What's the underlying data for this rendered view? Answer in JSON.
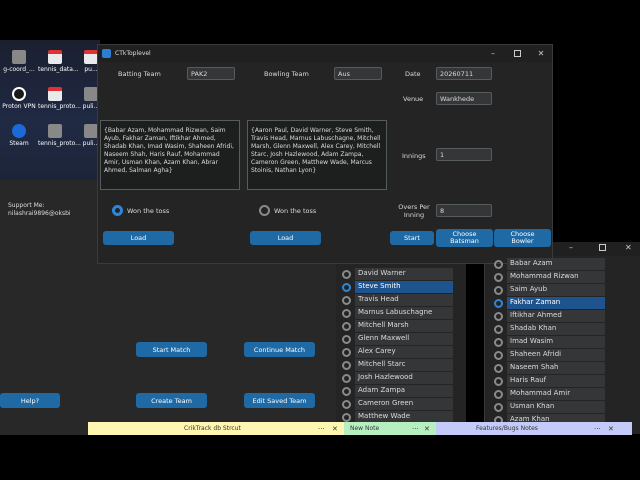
{
  "desktop": {
    "icons": [
      {
        "label": "g-coord_..."
      },
      {
        "label": "tennis_data..."
      },
      {
        "label": "pu..."
      },
      {
        "label": "Proton VPN"
      },
      {
        "label": "tennis_proto..."
      },
      {
        "label": "puli..."
      },
      {
        "label": "Steam"
      },
      {
        "label": "tennis_proto..."
      },
      {
        "label": "puli..."
      }
    ]
  },
  "bg_app": {
    "support_label": "Support Me:",
    "support_id": "nilashrai9896@oksbi",
    "start_match": "Start Match",
    "continue_match": "Continue Match",
    "help": "Help?",
    "create_team": "Create Team",
    "edit_saved_team": "Edit Saved Team"
  },
  "ctk": {
    "title": "CTkToplevel",
    "batting_team_label": "Batting Team",
    "batting_team_value": "PAK2",
    "bowling_team_label": "Bowling Team",
    "bowling_team_value": "Aus",
    "date_label": "Date",
    "date_value": "20260711",
    "venue_label": "Venue",
    "venue_value": "Wankhede",
    "innings_label": "Innings",
    "innings_value": "1",
    "overs_label": "Overs Per Inning",
    "overs_value": "8",
    "batting_players": "{Babar Azam, Mohammad Rizwan, Saim Ayub, Fakhar Zaman, Iftikhar Ahmed, Shadab Khan, Imad Wasim, Shaheen Afridi, Naseem Shah, Haris Rauf, Mohammad Amir, Usman Khan, Azam Khan, Abrar Ahmed, Salman Agha}",
    "bowling_players": "{Aaron Paul, David Warner, Steve Smith, Travis Head, Marnus Labuschagne, Mitchell Marsh, Glenn Maxwell, Alex Carey, Mitchell Starc, Josh Hazlewood, Adam Zampa, Cameron Green, Matthew Wade, Marcus Stoinis, Nathan Lyon}",
    "won_toss_1": "Won the toss",
    "won_toss_2": "Won the toss",
    "load_1": "Load",
    "load_2": "Load",
    "start": "Start",
    "choose_batsman": "Choose Batsman",
    "choose_bowler": "Choose Bowler"
  },
  "aus_list": [
    "David Warner",
    "Steve Smith",
    "Travis Head",
    "Marnus Labuschagne",
    "Mitchell Marsh",
    "Glenn Maxwell",
    "Alex Carey",
    "Mitchell Starc",
    "Josh Hazlewood",
    "Adam Zampa",
    "Cameron Green",
    "Matthew Wade"
  ],
  "aus_selected": "Steve Smith",
  "pak_list": [
    "Babar Azam",
    "Mohammad Rizwan",
    "Saim Ayub",
    "Fakhar Zaman",
    "Iftikhar Ahmed",
    "Shadab Khan",
    "Imad Wasim",
    "Shaheen Afridi",
    "Naseem Shah",
    "Haris Rauf",
    "Mohammad Amir",
    "Usman Khan",
    "Azam Khan"
  ],
  "pak_selected": "Fakhar Zaman",
  "sticky": {
    "n1": "CrikTrack db Strcut",
    "n2": "New Note",
    "n3": "Features/Bugs Notes",
    "more": "···",
    "close": "✕"
  },
  "colors": {
    "accent": "#1f6aa5",
    "selected": "#1f538d",
    "note_yellow": "#fff7b1",
    "note_green": "#b6f0c0",
    "note_purple": "#c5cbf8"
  }
}
